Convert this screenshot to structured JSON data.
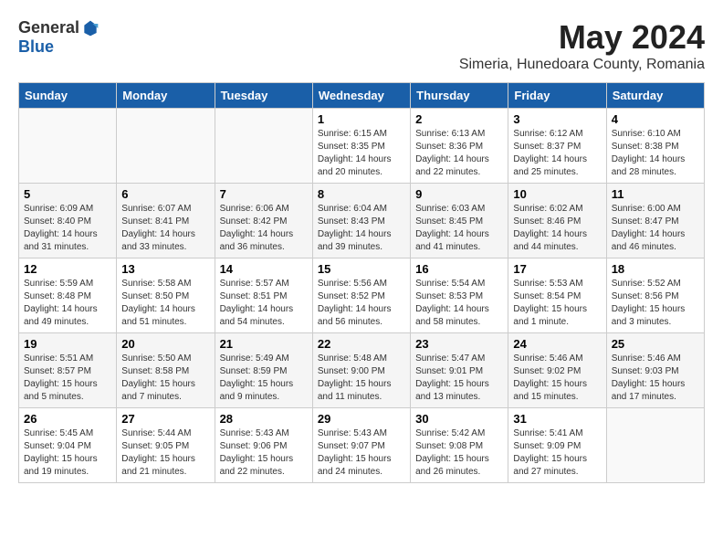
{
  "logo": {
    "general": "General",
    "blue": "Blue"
  },
  "title": "May 2024",
  "subtitle": "Simeria, Hunedoara County, Romania",
  "days_header": [
    "Sunday",
    "Monday",
    "Tuesday",
    "Wednesday",
    "Thursday",
    "Friday",
    "Saturday"
  ],
  "weeks": [
    [
      {
        "day": "",
        "info": ""
      },
      {
        "day": "",
        "info": ""
      },
      {
        "day": "",
        "info": ""
      },
      {
        "day": "1",
        "info": "Sunrise: 6:15 AM\nSunset: 8:35 PM\nDaylight: 14 hours\nand 20 minutes."
      },
      {
        "day": "2",
        "info": "Sunrise: 6:13 AM\nSunset: 8:36 PM\nDaylight: 14 hours\nand 22 minutes."
      },
      {
        "day": "3",
        "info": "Sunrise: 6:12 AM\nSunset: 8:37 PM\nDaylight: 14 hours\nand 25 minutes."
      },
      {
        "day": "4",
        "info": "Sunrise: 6:10 AM\nSunset: 8:38 PM\nDaylight: 14 hours\nand 28 minutes."
      }
    ],
    [
      {
        "day": "5",
        "info": "Sunrise: 6:09 AM\nSunset: 8:40 PM\nDaylight: 14 hours\nand 31 minutes."
      },
      {
        "day": "6",
        "info": "Sunrise: 6:07 AM\nSunset: 8:41 PM\nDaylight: 14 hours\nand 33 minutes."
      },
      {
        "day": "7",
        "info": "Sunrise: 6:06 AM\nSunset: 8:42 PM\nDaylight: 14 hours\nand 36 minutes."
      },
      {
        "day": "8",
        "info": "Sunrise: 6:04 AM\nSunset: 8:43 PM\nDaylight: 14 hours\nand 39 minutes."
      },
      {
        "day": "9",
        "info": "Sunrise: 6:03 AM\nSunset: 8:45 PM\nDaylight: 14 hours\nand 41 minutes."
      },
      {
        "day": "10",
        "info": "Sunrise: 6:02 AM\nSunset: 8:46 PM\nDaylight: 14 hours\nand 44 minutes."
      },
      {
        "day": "11",
        "info": "Sunrise: 6:00 AM\nSunset: 8:47 PM\nDaylight: 14 hours\nand 46 minutes."
      }
    ],
    [
      {
        "day": "12",
        "info": "Sunrise: 5:59 AM\nSunset: 8:48 PM\nDaylight: 14 hours\nand 49 minutes."
      },
      {
        "day": "13",
        "info": "Sunrise: 5:58 AM\nSunset: 8:50 PM\nDaylight: 14 hours\nand 51 minutes."
      },
      {
        "day": "14",
        "info": "Sunrise: 5:57 AM\nSunset: 8:51 PM\nDaylight: 14 hours\nand 54 minutes."
      },
      {
        "day": "15",
        "info": "Sunrise: 5:56 AM\nSunset: 8:52 PM\nDaylight: 14 hours\nand 56 minutes."
      },
      {
        "day": "16",
        "info": "Sunrise: 5:54 AM\nSunset: 8:53 PM\nDaylight: 14 hours\nand 58 minutes."
      },
      {
        "day": "17",
        "info": "Sunrise: 5:53 AM\nSunset: 8:54 PM\nDaylight: 15 hours\nand 1 minute."
      },
      {
        "day": "18",
        "info": "Sunrise: 5:52 AM\nSunset: 8:56 PM\nDaylight: 15 hours\nand 3 minutes."
      }
    ],
    [
      {
        "day": "19",
        "info": "Sunrise: 5:51 AM\nSunset: 8:57 PM\nDaylight: 15 hours\nand 5 minutes."
      },
      {
        "day": "20",
        "info": "Sunrise: 5:50 AM\nSunset: 8:58 PM\nDaylight: 15 hours\nand 7 minutes."
      },
      {
        "day": "21",
        "info": "Sunrise: 5:49 AM\nSunset: 8:59 PM\nDaylight: 15 hours\nand 9 minutes."
      },
      {
        "day": "22",
        "info": "Sunrise: 5:48 AM\nSunset: 9:00 PM\nDaylight: 15 hours\nand 11 minutes."
      },
      {
        "day": "23",
        "info": "Sunrise: 5:47 AM\nSunset: 9:01 PM\nDaylight: 15 hours\nand 13 minutes."
      },
      {
        "day": "24",
        "info": "Sunrise: 5:46 AM\nSunset: 9:02 PM\nDaylight: 15 hours\nand 15 minutes."
      },
      {
        "day": "25",
        "info": "Sunrise: 5:46 AM\nSunset: 9:03 PM\nDaylight: 15 hours\nand 17 minutes."
      }
    ],
    [
      {
        "day": "26",
        "info": "Sunrise: 5:45 AM\nSunset: 9:04 PM\nDaylight: 15 hours\nand 19 minutes."
      },
      {
        "day": "27",
        "info": "Sunrise: 5:44 AM\nSunset: 9:05 PM\nDaylight: 15 hours\nand 21 minutes."
      },
      {
        "day": "28",
        "info": "Sunrise: 5:43 AM\nSunset: 9:06 PM\nDaylight: 15 hours\nand 22 minutes."
      },
      {
        "day": "29",
        "info": "Sunrise: 5:43 AM\nSunset: 9:07 PM\nDaylight: 15 hours\nand 24 minutes."
      },
      {
        "day": "30",
        "info": "Sunrise: 5:42 AM\nSunset: 9:08 PM\nDaylight: 15 hours\nand 26 minutes."
      },
      {
        "day": "31",
        "info": "Sunrise: 5:41 AM\nSunset: 9:09 PM\nDaylight: 15 hours\nand 27 minutes."
      },
      {
        "day": "",
        "info": ""
      }
    ]
  ]
}
